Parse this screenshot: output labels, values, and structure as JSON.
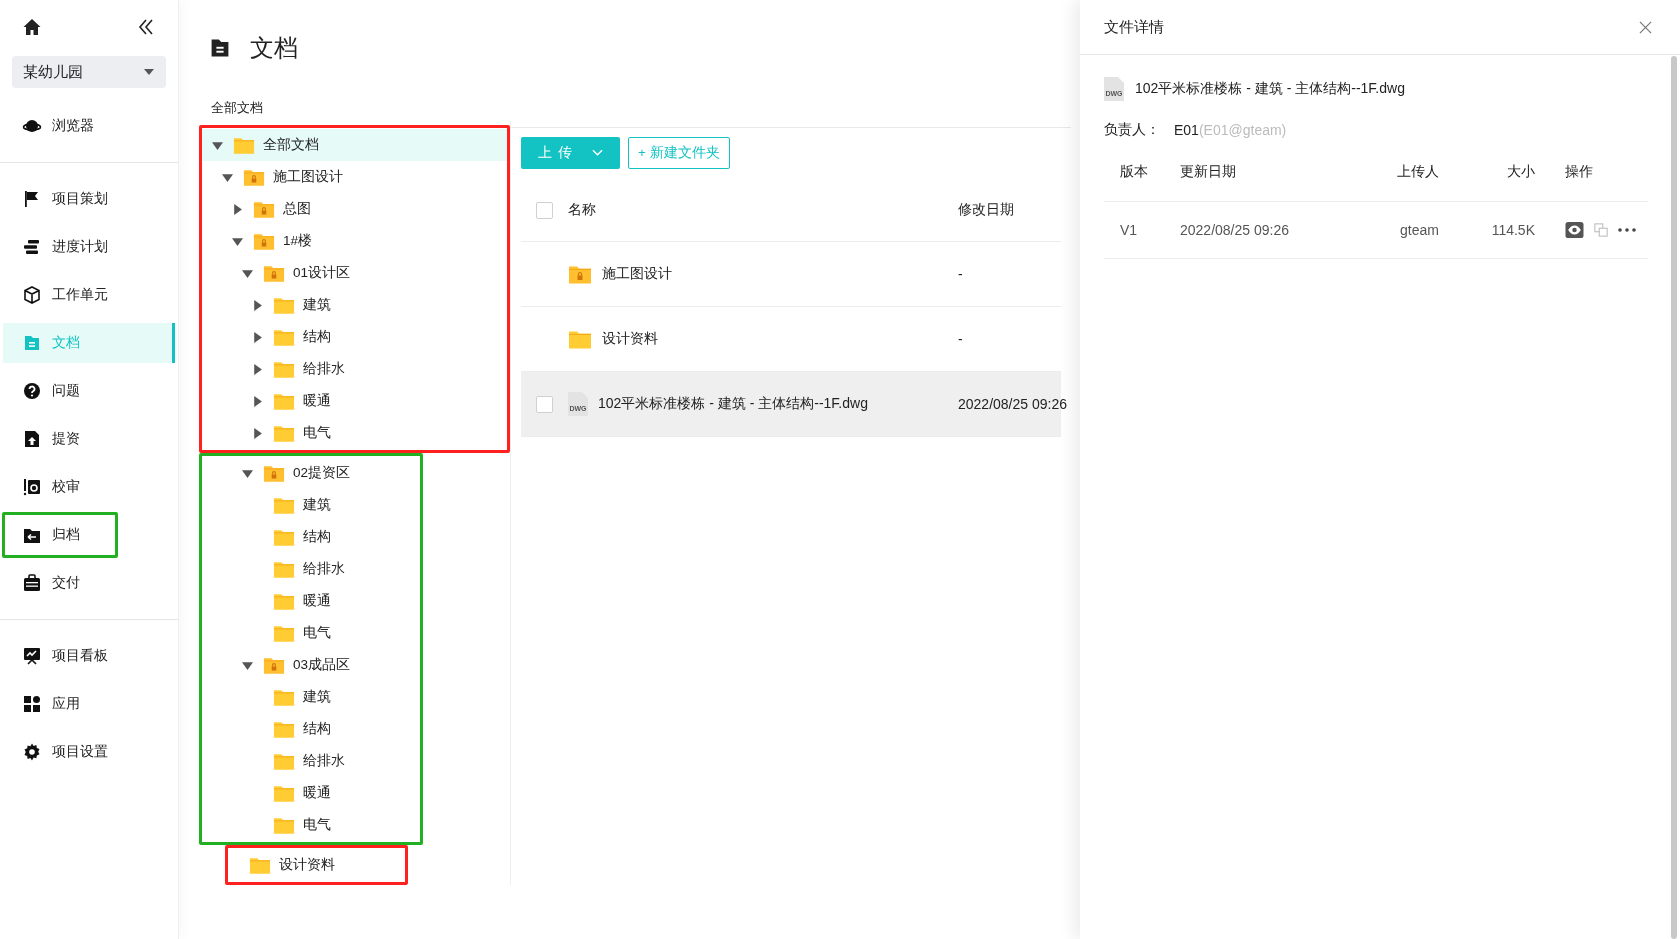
{
  "sidebar": {
    "project": "某幼儿园",
    "groups": [
      [
        {
          "label": "浏览器",
          "selected": false
        }
      ],
      [
        {
          "label": "项目策划",
          "selected": false
        },
        {
          "label": "进度计划",
          "selected": false
        },
        {
          "label": "工作单元",
          "selected": false
        },
        {
          "label": "文档",
          "selected": true
        },
        {
          "label": "问题",
          "selected": false
        },
        {
          "label": "提资",
          "selected": false
        },
        {
          "label": "校审",
          "selected": false
        },
        {
          "label": "归档",
          "selected": false,
          "color": "#22b022"
        },
        {
          "label": "交付",
          "selected": false
        }
      ],
      [
        {
          "label": "项目看板",
          "selected": false
        },
        {
          "label": "应用",
          "selected": false
        },
        {
          "label": "项目设置",
          "selected": false
        }
      ]
    ]
  },
  "page": {
    "title": "文档",
    "breadcrumb": "全部文档"
  },
  "tree": [
    {
      "label": "全部文档",
      "locked": false,
      "expanded": true,
      "selected": true,
      "color": "#ff2020",
      "children": [
        {
          "label": "施工图设计",
          "locked": true,
          "expanded": true,
          "selected": false,
          "children": [
            {
              "label": "总图",
              "locked": true,
              "expanded": false,
              "selected": false
            },
            {
              "label": "1#楼",
              "locked": true,
              "expanded": true,
              "selected": false,
              "children": [
                {
                  "label": "01设计区",
                  "locked": true,
                  "expanded": true,
                  "selected": false,
                  "children": [
                    {
                      "label": "建筑",
                      "locked": false,
                      "expanded": false,
                      "selected": false
                    },
                    {
                      "label": "结构",
                      "locked": false,
                      "expanded": false,
                      "selected": false
                    },
                    {
                      "label": "给排水",
                      "locked": false,
                      "expanded": false,
                      "selected": false
                    },
                    {
                      "label": "暖通",
                      "locked": false,
                      "expanded": false,
                      "selected": false
                    },
                    {
                      "label": "电气",
                      "locked": false,
                      "expanded": false,
                      "selected": false
                    }
                  ]
                },
                {
                  "label": "02提资区",
                  "locked": true,
                  "expanded": true,
                  "selected": false,
                  "color": "#22b022",
                  "children": [
                    {
                      "label": "建筑",
                      "locked": false,
                      "selected": false
                    },
                    {
                      "label": "结构",
                      "locked": false,
                      "selected": false
                    },
                    {
                      "label": "给排水",
                      "locked": false,
                      "selected": false
                    },
                    {
                      "label": "暖通",
                      "locked": false,
                      "selected": false
                    },
                    {
                      "label": "电气",
                      "locked": false,
                      "selected": false
                    }
                  ]
                },
                {
                  "label": "03成品区",
                  "locked": true,
                  "expanded": true,
                  "selected": false,
                  "children": [
                    {
                      "label": "建筑",
                      "locked": false,
                      "selected": false
                    },
                    {
                      "label": "结构",
                      "locked": false,
                      "selected": false
                    },
                    {
                      "label": "给排水",
                      "locked": false,
                      "selected": false
                    },
                    {
                      "label": "暖通",
                      "locked": false,
                      "selected": false
                    },
                    {
                      "label": "电气",
                      "locked": false,
                      "selected": false
                    }
                  ]
                }
              ]
            }
          ]
        },
        {
          "label": "设计资料",
          "locked": false,
          "selected": false,
          "color": "#ff2020"
        }
      ]
    }
  ],
  "toolbar": {
    "upload": "上传",
    "new_folder": "+ 新建文件夹"
  },
  "list": {
    "columns": [
      "名称",
      "修改日期"
    ],
    "header_checked": false,
    "rows": [
      {
        "kind": "folder",
        "name": "施工图设计",
        "locked": true,
        "modified": "-",
        "selected": false
      },
      {
        "kind": "folder",
        "name": "设计资料",
        "locked": false,
        "modified": "-",
        "selected": false
      },
      {
        "kind": "file",
        "file_type": "DWG",
        "name": "102平米标准楼栋 - 建筑 - 主体结构--1F.dwg",
        "modified": "2022/08/25 09:26",
        "checked": false,
        "selected": true
      }
    ]
  },
  "detail": {
    "title": "文件详情",
    "file_type": "DWG",
    "file_name": "102平米标准楼栋 - 建筑 - 主体结构--1F.dwg",
    "owner_label": "负责人：",
    "owner": "E01",
    "owner_account": "(E01@gteam)",
    "columns": [
      "版本",
      "更新日期",
      "上传人",
      "大小",
      "操作"
    ],
    "versions": [
      {
        "version": "V1",
        "date": "2022/08/25 09:26",
        "uploader": "gteam",
        "size": "114.5K"
      }
    ]
  }
}
